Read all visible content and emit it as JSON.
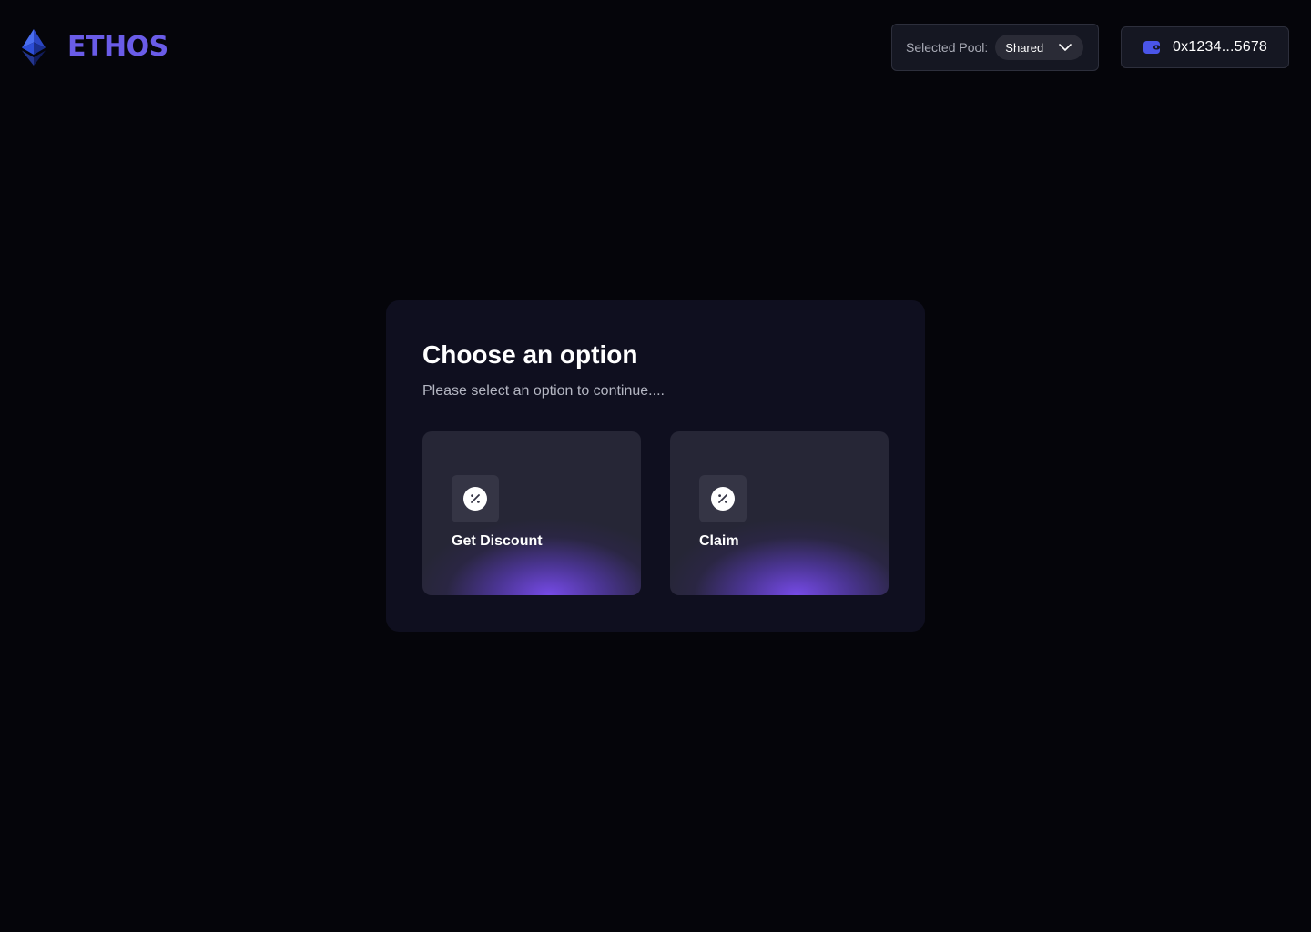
{
  "header": {
    "logo_text": "ETHOS",
    "logo_icon": "ethereum-diamond-icon",
    "pool_label": "Selected Pool:",
    "pool_value": "Shared",
    "wallet_icon": "wallet-icon",
    "wallet_address": "0x1234...5678"
  },
  "modal": {
    "title": "Choose an option",
    "subtitle": "Please select an option to continue....",
    "options": [
      {
        "label": "Get Discount",
        "icon": "percent-badge-icon"
      },
      {
        "label": "Claim",
        "icon": "percent-badge-icon"
      }
    ]
  },
  "colors": {
    "background": "#05050a",
    "card": "#0f0f1f",
    "tile": "#262636",
    "accent": "#6a5ce8",
    "glow": "#7a4cf0"
  }
}
